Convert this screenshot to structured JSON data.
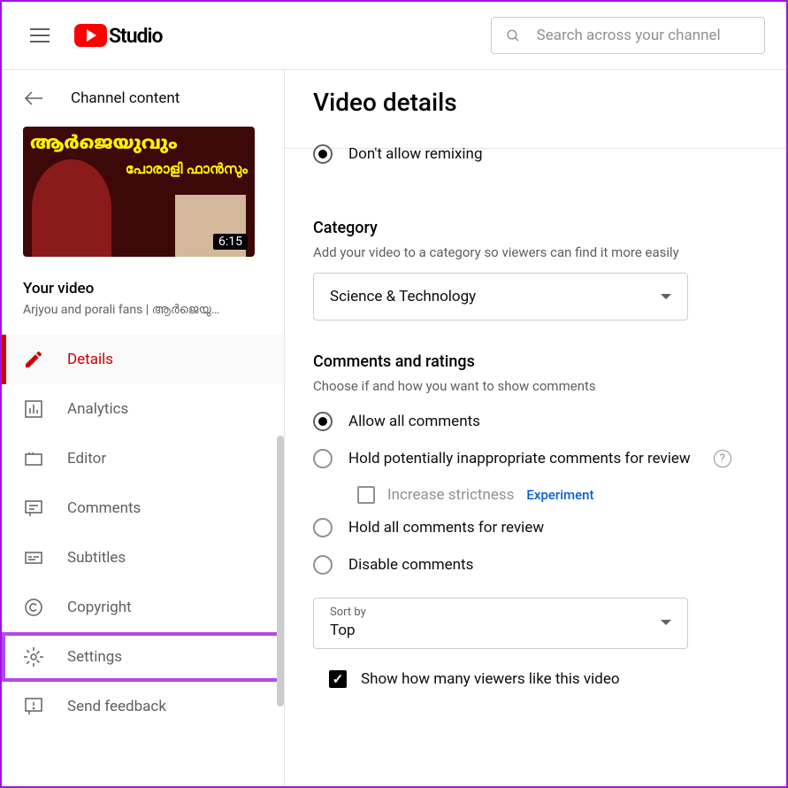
{
  "header": {
    "logo_text": "Studio",
    "search_placeholder": "Search across your channel"
  },
  "sidebar": {
    "back_label": "Channel content",
    "thumbnail": {
      "duration": "6:15",
      "text1": "ആർജെയുവും",
      "text2": "പോരാളി ഫാൻസും"
    },
    "your_video_label": "Your video",
    "video_name": "Arjyou and porali fans | ആർജെയു…",
    "items": [
      {
        "label": "Details"
      },
      {
        "label": "Analytics"
      },
      {
        "label": "Editor"
      },
      {
        "label": "Comments"
      },
      {
        "label": "Subtitles"
      },
      {
        "label": "Copyright"
      },
      {
        "label": "Settings"
      },
      {
        "label": "Send feedback"
      }
    ]
  },
  "main": {
    "title": "Video details",
    "remix_option": "Don't allow remixing",
    "category": {
      "heading": "Category",
      "desc": "Add your video to a category so viewers can find it more easily",
      "value": "Science & Technology"
    },
    "comments": {
      "heading": "Comments and ratings",
      "desc": "Choose if and how you want to show comments",
      "options": [
        "Allow all comments",
        "Hold potentially inappropriate comments for review",
        "Hold all comments for review",
        "Disable comments"
      ],
      "strictness_label": "Increase strictness",
      "experiment_label": "Experiment"
    },
    "sort": {
      "label": "Sort by",
      "value": "Top"
    },
    "likes_checkbox": "Show how many viewers like this video"
  }
}
